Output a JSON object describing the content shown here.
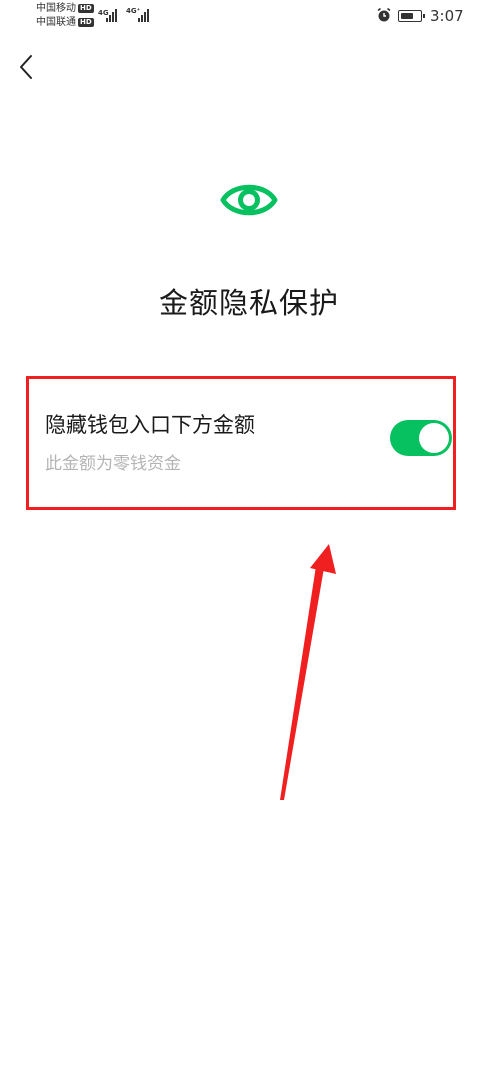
{
  "status_bar": {
    "carrier_1": "中国移动",
    "carrier_2": "中国联通",
    "hd_1": "HD",
    "hd_2": "HD",
    "net_1": "4G",
    "net_2": "4G⁺",
    "time": "3:07",
    "icons": [
      "signal-icon",
      "alarm-icon",
      "battery-icon"
    ],
    "battery_level": 0.7
  },
  "nav": {
    "back_icon": "chevron-left-icon"
  },
  "header": {
    "icon": "eye-icon",
    "title": "金额隐私保护"
  },
  "setting": {
    "title": "隐藏钱包入口下方金额",
    "subtitle": "此金额为零钱资金",
    "enabled": true
  },
  "colors": {
    "accent": "#07c160",
    "annotation": "#f02020",
    "subtitle": "#b4b4b4"
  }
}
